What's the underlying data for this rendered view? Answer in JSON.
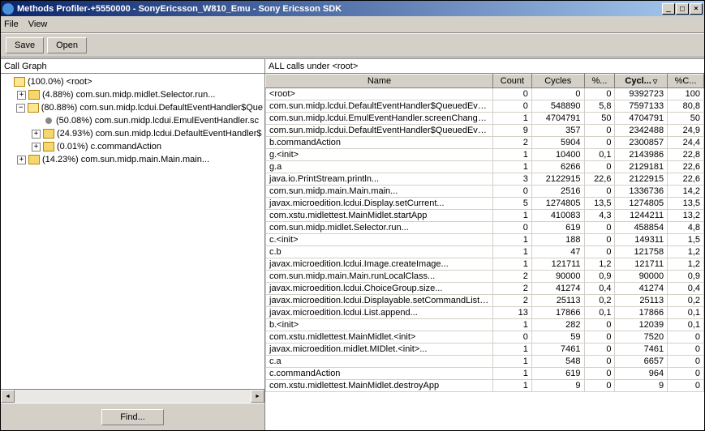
{
  "window": {
    "title": "Methods Profiler-+5550000 - SonyEricsson_W810_Emu - Sony Ericsson SDK",
    "min": "_",
    "max": "□",
    "close": "×"
  },
  "menu": {
    "file": "File",
    "view": "View"
  },
  "toolbar": {
    "save": "Save",
    "open": "Open"
  },
  "left": {
    "header": "Call Graph",
    "find": "Find...",
    "tree": [
      {
        "depth": 0,
        "exp": "none",
        "icon": "folder-open",
        "label": "(100.0%) <root>"
      },
      {
        "depth": 1,
        "exp": "plus",
        "icon": "folder",
        "label": "(4.88%) com.sun.midp.midlet.Selector.run..."
      },
      {
        "depth": 1,
        "exp": "minus",
        "icon": "folder-open",
        "label": "(80.88%) com.sun.midp.lcdui.DefaultEventHandler$Que"
      },
      {
        "depth": 2,
        "exp": "none",
        "icon": "bullet",
        "label": "(50.08%) com.sun.midp.lcdui.EmulEventHandler.sc"
      },
      {
        "depth": 2,
        "exp": "plus",
        "icon": "folder",
        "label": "(24.93%) com.sun.midp.lcdui.DefaultEventHandler$"
      },
      {
        "depth": 2,
        "exp": "plus",
        "icon": "folder",
        "label": "(0.01%) c.commandAction"
      },
      {
        "depth": 1,
        "exp": "plus",
        "icon": "folder",
        "label": "(14.23%) com.sun.midp.main.Main.main..."
      }
    ]
  },
  "right": {
    "title": "ALL calls under <root>",
    "columns": [
      "Name",
      "Count",
      "Cycles",
      "%...",
      "Cycl...",
      "%C..."
    ],
    "sortCol": 4,
    "rows": [
      {
        "name": "<root>",
        "vals": [
          "0",
          "0",
          "0",
          "9392723",
          "100"
        ]
      },
      {
        "name": "com.sun.midp.lcdui.DefaultEventHandler$QueuedEventH...",
        "vals": [
          "0",
          "548890",
          "5,8",
          "7597133",
          "80,8"
        ]
      },
      {
        "name": "com.sun.midp.lcdui.EmulEventHandler.screenChangeEve...",
        "vals": [
          "1",
          "4704791",
          "50",
          "4704791",
          "50"
        ]
      },
      {
        "name": "com.sun.midp.lcdui.DefaultEventHandler$QueuedEventH...",
        "vals": [
          "9",
          "357",
          "0",
          "2342488",
          "24,9"
        ]
      },
      {
        "name": "b.commandAction",
        "vals": [
          "2",
          "5904",
          "0",
          "2300857",
          "24,4"
        ]
      },
      {
        "name": "g.<init>",
        "vals": [
          "1",
          "10400",
          "0,1",
          "2143986",
          "22,8"
        ]
      },
      {
        "name": "g.a",
        "vals": [
          "1",
          "6266",
          "0",
          "2129181",
          "22,6"
        ]
      },
      {
        "name": "java.io.PrintStream.println...",
        "vals": [
          "3",
          "2122915",
          "22,6",
          "2122915",
          "22,6"
        ]
      },
      {
        "name": "com.sun.midp.main.Main.main...",
        "vals": [
          "0",
          "2516",
          "0",
          "1336736",
          "14,2"
        ]
      },
      {
        "name": "javax.microedition.lcdui.Display.setCurrent...",
        "vals": [
          "5",
          "1274805",
          "13,5",
          "1274805",
          "13,5"
        ]
      },
      {
        "name": "com.xstu.midlettest.MainMidlet.startApp",
        "vals": [
          "1",
          "410083",
          "4,3",
          "1244211",
          "13,2"
        ]
      },
      {
        "name": "com.sun.midp.midlet.Selector.run...",
        "vals": [
          "0",
          "619",
          "0",
          "458854",
          "4,8"
        ]
      },
      {
        "name": "c.<init>",
        "vals": [
          "1",
          "188",
          "0",
          "149311",
          "1,5"
        ]
      },
      {
        "name": "c.b",
        "vals": [
          "1",
          "47",
          "0",
          "121758",
          "1,2"
        ]
      },
      {
        "name": "javax.microedition.lcdui.Image.createImage...",
        "vals": [
          "1",
          "121711",
          "1,2",
          "121711",
          "1,2"
        ]
      },
      {
        "name": "com.sun.midp.main.Main.runLocalClass...",
        "vals": [
          "2",
          "90000",
          "0,9",
          "90000",
          "0,9"
        ]
      },
      {
        "name": "javax.microedition.lcdui.ChoiceGroup.size...",
        "vals": [
          "2",
          "41274",
          "0,4",
          "41274",
          "0,4"
        ]
      },
      {
        "name": "javax.microedition.lcdui.Displayable.setCommandListener...",
        "vals": [
          "2",
          "25113",
          "0,2",
          "25113",
          "0,2"
        ]
      },
      {
        "name": "javax.microedition.lcdui.List.append...",
        "vals": [
          "13",
          "17866",
          "0,1",
          "17866",
          "0,1"
        ]
      },
      {
        "name": "b.<init>",
        "vals": [
          "1",
          "282",
          "0",
          "12039",
          "0,1"
        ]
      },
      {
        "name": "com.xstu.midlettest.MainMidlet.<init>",
        "vals": [
          "0",
          "59",
          "0",
          "7520",
          "0"
        ]
      },
      {
        "name": "javax.microedition.midlet.MIDlet.<init>...",
        "vals": [
          "1",
          "7461",
          "0",
          "7461",
          "0"
        ]
      },
      {
        "name": "c.a",
        "vals": [
          "1",
          "548",
          "0",
          "6657",
          "0"
        ]
      },
      {
        "name": "c.commandAction",
        "vals": [
          "1",
          "619",
          "0",
          "964",
          "0"
        ]
      },
      {
        "name": "com.xstu.midlettest.MainMidlet.destroyApp",
        "vals": [
          "1",
          "9",
          "0",
          "9",
          "0"
        ]
      }
    ]
  }
}
